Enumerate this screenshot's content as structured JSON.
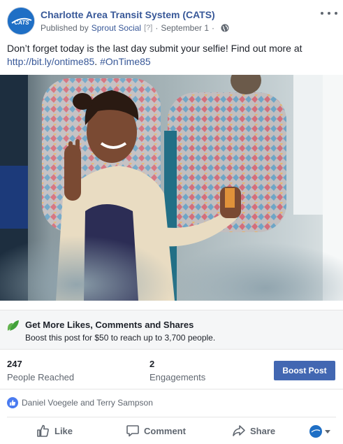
{
  "header": {
    "page_name": "Charlotte Area Transit System (CATS)",
    "published_by_label": "Published by",
    "publisher": "Sprout Social",
    "help": "[?]",
    "separator": "·",
    "date": "September 1",
    "avatar_text": "CATS"
  },
  "post": {
    "text_line1": "Don’t forget today is the last day submit your selfie! Find out more at",
    "link": "http://bit.ly/ontime85",
    "after_link": ".",
    "hashtag": "#OnTime85"
  },
  "boost_banner": {
    "title": "Get More Likes, Comments and Shares",
    "subtitle": "Boost this post for $50 to reach up to 3,700 people."
  },
  "stats": {
    "reached_count": "247",
    "reached_label": "People Reached",
    "engagements_count": "2",
    "engagements_label": "Engagements",
    "boost_button": "Boost Post"
  },
  "reactions": {
    "names": "Daniel Voegele and Terry Sampson"
  },
  "actions": {
    "like": "Like",
    "comment": "Comment",
    "share": "Share"
  },
  "colors": {
    "link": "#385898",
    "boost_button": "#4267b2",
    "muted_text": "#606770"
  },
  "icons": [
    "cats-logo-icon",
    "more-options-icon",
    "globe-icon",
    "leaf-icon",
    "like-badge-icon",
    "thumbs-up-icon",
    "comment-icon",
    "share-icon",
    "chevron-down-icon"
  ]
}
